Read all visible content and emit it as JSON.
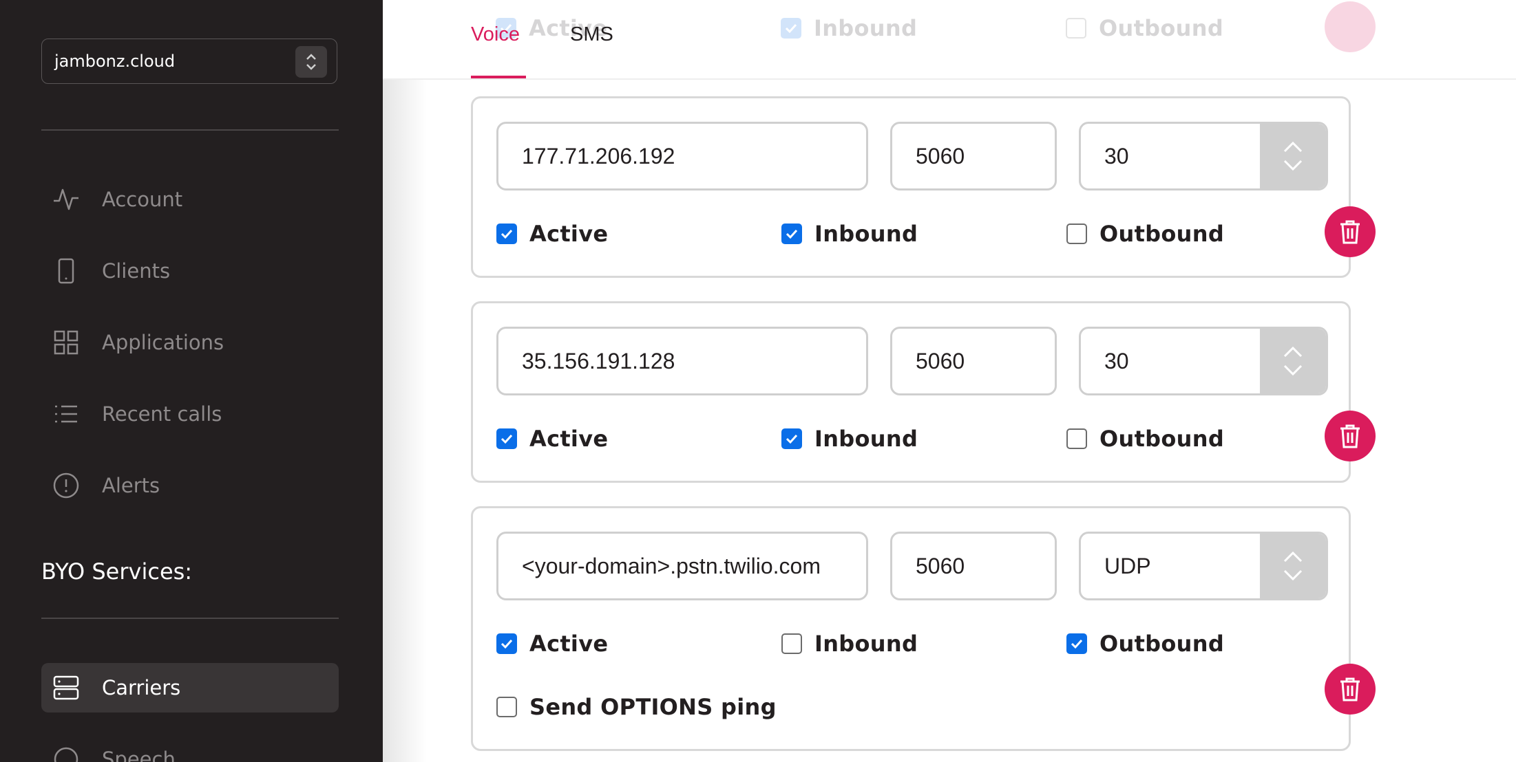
{
  "sidebar": {
    "account_select": {
      "value": "jambonz.cloud"
    },
    "nav": [
      {
        "label": "Account",
        "icon": "activity-icon"
      },
      {
        "label": "Clients",
        "icon": "phone-device-icon"
      },
      {
        "label": "Applications",
        "icon": "grid-icon"
      },
      {
        "label": "Recent calls",
        "icon": "list-icon"
      },
      {
        "label": "Alerts",
        "icon": "alert-circle-icon"
      }
    ],
    "byo_title": "BYO Services:",
    "byo_nav": [
      {
        "label": "Carriers",
        "icon": "server-icon",
        "active": true
      },
      {
        "label": "Speech",
        "icon": "circle-icon"
      }
    ]
  },
  "tabs": [
    {
      "label": "Voice",
      "active": true
    },
    {
      "label": "SMS",
      "active": false
    }
  ],
  "ghost_row": {
    "active_label": "Active",
    "inbound_label": "Inbound",
    "outbound_label": "Outbound",
    "active": true,
    "inbound": true,
    "outbound": false
  },
  "gateways": [
    {
      "ip": "177.71.206.192",
      "port": "5060",
      "select": "30",
      "active_label": "Active",
      "inbound_label": "Inbound",
      "outbound_label": "Outbound",
      "active": true,
      "inbound": true,
      "outbound": false
    },
    {
      "ip": "35.156.191.128",
      "port": "5060",
      "select": "30",
      "active_label": "Active",
      "inbound_label": "Inbound",
      "outbound_label": "Outbound",
      "active": true,
      "inbound": true,
      "outbound": false
    },
    {
      "ip": "<your-domain>.pstn.twilio.com",
      "port": "5060",
      "select": "UDP",
      "active_label": "Active",
      "inbound_label": "Inbound",
      "outbound_label": "Outbound",
      "options_ping_label": "Send OPTIONS ping",
      "active": true,
      "inbound": false,
      "outbound": true,
      "options_ping": false
    }
  ],
  "colors": {
    "sidebar_bg": "#231f20",
    "accent": "#da1c5c",
    "checkbox": "#0a6ee8"
  }
}
